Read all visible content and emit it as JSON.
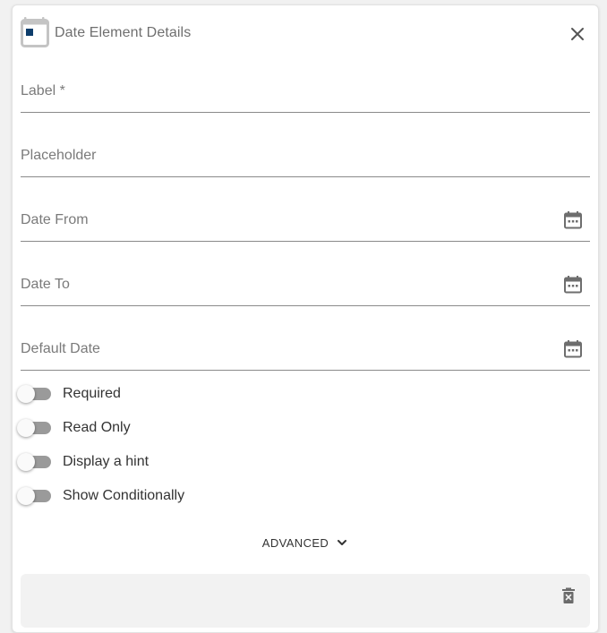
{
  "dialog": {
    "title": "Date Element Details",
    "icon": "calendar-icon",
    "accent_color": "#0d3d6b"
  },
  "fields": {
    "label": {
      "label": "Label *",
      "value": ""
    },
    "placeholder": {
      "label": "Placeholder",
      "value": ""
    },
    "date_from": {
      "label": "Date From",
      "value": ""
    },
    "date_to": {
      "label": "Date To",
      "value": ""
    },
    "default_date": {
      "label": "Default Date",
      "value": ""
    }
  },
  "toggles": {
    "required": {
      "label": "Required",
      "checked": false
    },
    "read_only": {
      "label": "Read Only",
      "checked": false
    },
    "display_hint": {
      "label": "Display a hint",
      "checked": false
    },
    "show_conditionally": {
      "label": "Show Conditionally",
      "checked": false
    }
  },
  "advanced": {
    "label": "ADVANCED",
    "icon": "chevron-down-icon"
  },
  "actions": {
    "delete_icon": "delete-icon"
  }
}
